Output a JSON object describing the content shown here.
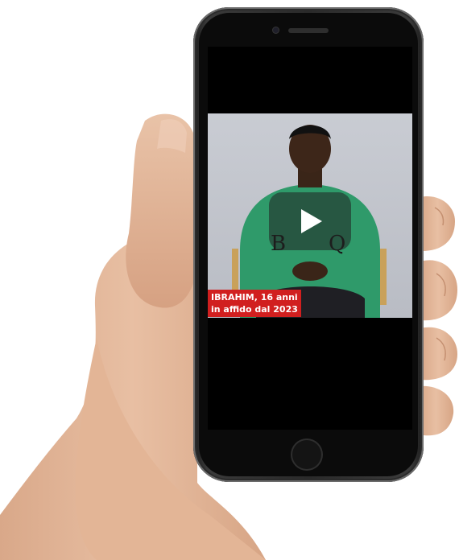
{
  "video": {
    "caption_line1": "IBRAHIM, 16 anni",
    "caption_line2": "in affido dal 2023",
    "play_icon": "play-triangle-icon",
    "caption_color": "#d11f1f",
    "background_color": "#c9ccd3"
  },
  "phone": {
    "frame_color": "#2a2a2a",
    "screen_color": "#000000"
  }
}
